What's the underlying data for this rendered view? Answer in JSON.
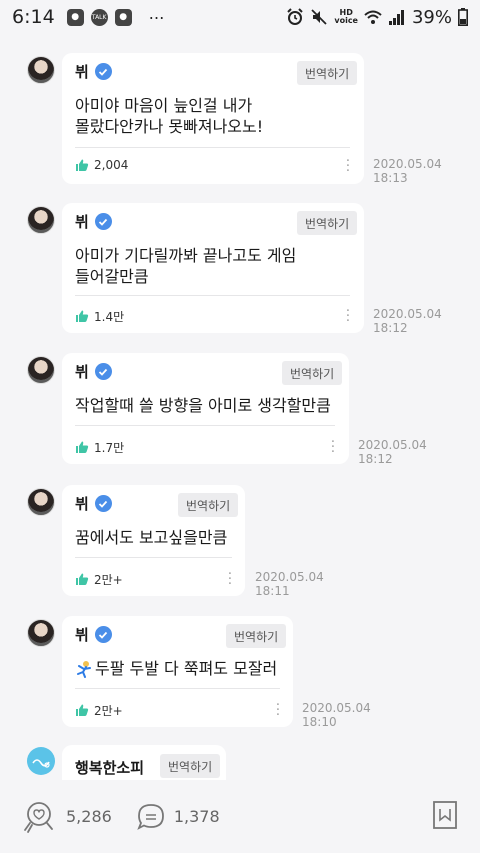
{
  "status_bar": {
    "time": "6:14",
    "app_icons": [
      "chat-bubble-icon",
      "talk-icon",
      "chat-bubble-icon"
    ],
    "talk_label": "TALK",
    "more": "⋯",
    "hd_label": "HD",
    "voice_label": "voice",
    "battery": "39%"
  },
  "comments": [
    {
      "author": "뷔",
      "translate_label": "번역하기",
      "text": "아미야 마음이 늪인걸 내가\n몰랐다안카나 못빠져나오노!",
      "likes": "2,004",
      "date": "2020.05.04",
      "time": "18:13"
    },
    {
      "author": "뷔",
      "translate_label": "번역하기",
      "text": "아미가 기다릴까봐 끝나고도 게임\n들어갈만큼",
      "likes": "1.4만",
      "date": "2020.05.04",
      "time": "18:12"
    },
    {
      "author": "뷔",
      "translate_label": "번역하기",
      "text": "작업할때 쓸 방향을 아미로 생각할만큼",
      "likes": "1.7만",
      "date": "2020.05.04",
      "time": "18:12"
    },
    {
      "author": "뷔",
      "translate_label": "번역하기",
      "text": "꿈에서도 보고싶을만큼",
      "likes": "2만+",
      "date": "2020.05.04",
      "time": "18:11"
    },
    {
      "author": "뷔",
      "translate_label": "번역하기",
      "text": "두팔 두발 다 쭉펴도 모잘러",
      "likes": "2만+",
      "date": "2020.05.04",
      "time": "18:10"
    },
    {
      "author": "행복한소피",
      "translate_label": "번역하기"
    }
  ],
  "bottom_bar": {
    "reactions": "5,286",
    "comments": "1,378"
  },
  "colors": {
    "verified": "#4a8ee8",
    "like": "#3fc5a6",
    "background": "#f5f5f7"
  }
}
